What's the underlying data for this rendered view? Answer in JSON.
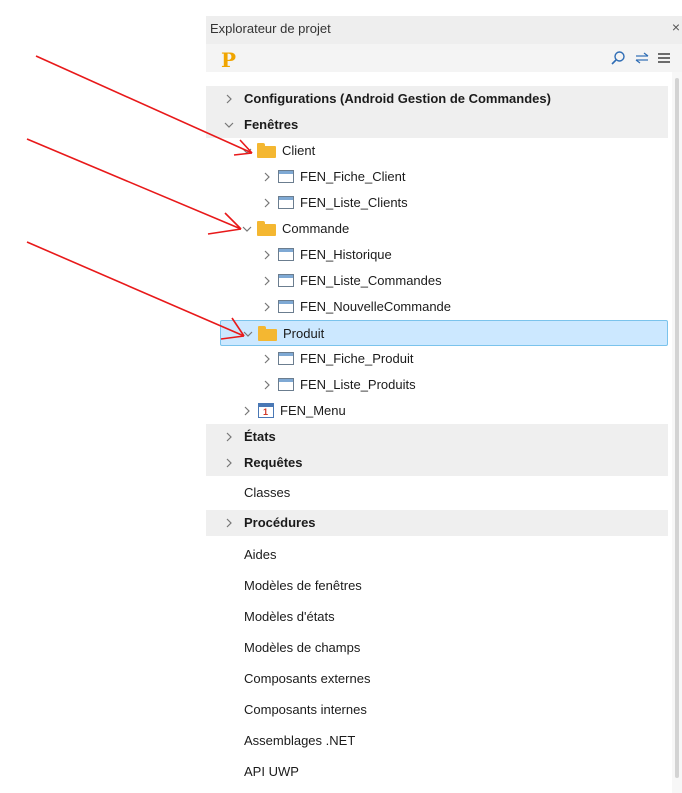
{
  "panel": {
    "title": "Explorateur de projet",
    "close_glyph": "×"
  },
  "toolbar": {
    "logo_letter": "P",
    "icons": [
      "search-icon",
      "sync-icon",
      "menu-icon"
    ]
  },
  "tree": {
    "configurations": "Configurations (Android Gestion de Commandes)",
    "fenetres": "Fenêtres",
    "client": "Client",
    "fen_fiche_client": "FEN_Fiche_Client",
    "fen_liste_clients": "FEN_Liste_Clients",
    "commande": "Commande",
    "fen_historique": "FEN_Historique",
    "fen_liste_commandes": "FEN_Liste_Commandes",
    "fen_nouvelle_commande": "FEN_NouvelleCommande",
    "produit": "Produit",
    "fen_fiche_produit": "FEN_Fiche_Produit",
    "fen_liste_produits": "FEN_Liste_Produits",
    "fen_menu": "FEN_Menu",
    "menu_icon_glyph": "1",
    "etats": "États",
    "requetes": "Requêtes",
    "classes": "Classes",
    "procedures": "Procédures",
    "aides": "Aides",
    "modeles_fenetres": "Modèles de fenêtres",
    "modeles_etats": "Modèles d'états",
    "modeles_champs": "Modèles de champs",
    "composants_externes": "Composants externes",
    "composants_internes": "Composants internes",
    "assemblages_net": "Assemblages .NET",
    "api_uwp": "API UWP"
  },
  "colors": {
    "arrow": "#e8191a",
    "selection": "#cce8ff",
    "folder": "#f4b731",
    "section_bg": "#efefef"
  }
}
